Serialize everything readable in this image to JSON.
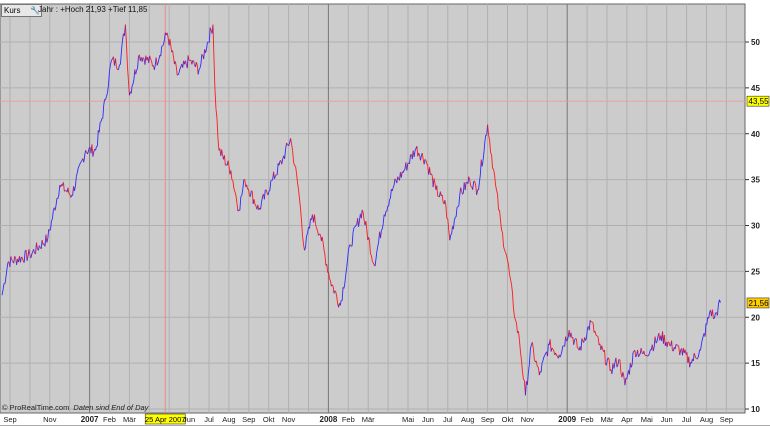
{
  "header": {
    "series_label": "Kurs",
    "info": "Jahr : +Hoch 21,93 +Tief 11,85"
  },
  "footer": {
    "copyright": "© ProRealTime.com",
    "note": "Daten sind End of Day"
  },
  "colors": {
    "up": "#2b2bff",
    "down": "#ff1a1a",
    "plot_bg": "#cccccc",
    "highlight": "#ffff00",
    "last": "#ffcc00"
  },
  "chart_data": {
    "type": "line",
    "title": "Kurs",
    "x_unit": "months since Sep 2006",
    "ylim": [
      10,
      54
    ],
    "y_ticks": [
      10,
      15,
      20,
      25,
      30,
      35,
      40,
      45,
      50
    ],
    "x_range": [
      -0.5,
      37
    ],
    "x_ticks": [
      {
        "m": 0,
        "label": "Sep"
      },
      {
        "m": 2,
        "label": "Nov"
      },
      {
        "m": 4,
        "label": "2007",
        "year": true
      },
      {
        "m": 5,
        "label": "Feb"
      },
      {
        "m": 6,
        "label": "Mär"
      },
      {
        "m": 7.8,
        "label": "25 Apr 2007",
        "highlight": true
      },
      {
        "m": 9,
        "label": "Jun"
      },
      {
        "m": 10,
        "label": "Jul"
      },
      {
        "m": 11,
        "label": "Aug"
      },
      {
        "m": 12,
        "label": "Sep"
      },
      {
        "m": 13,
        "label": "Okt"
      },
      {
        "m": 14,
        "label": "Nov"
      },
      {
        "m": 16,
        "label": "2008",
        "year": true
      },
      {
        "m": 17,
        "label": "Feb"
      },
      {
        "m": 18,
        "label": "Mär"
      },
      {
        "m": 20,
        "label": "Mai"
      },
      {
        "m": 21,
        "label": "Jun"
      },
      {
        "m": 22,
        "label": "Jul"
      },
      {
        "m": 23,
        "label": "Aug"
      },
      {
        "m": 24,
        "label": "Sep"
      },
      {
        "m": 25,
        "label": "Okt"
      },
      {
        "m": 26,
        "label": "Nov"
      },
      {
        "m": 28,
        "label": "2009",
        "year": true
      },
      {
        "m": 29,
        "label": "Feb"
      },
      {
        "m": 30,
        "label": "Mär"
      },
      {
        "m": 31,
        "label": "Apr"
      },
      {
        "m": 32,
        "label": "Mai"
      },
      {
        "m": 33,
        "label": "Jun"
      },
      {
        "m": 34,
        "label": "Jul"
      },
      {
        "m": 35,
        "label": "Aug"
      },
      {
        "m": 36,
        "label": "Sep"
      }
    ],
    "cursor": {
      "m": 7.8,
      "value": 43.55,
      "label": "43,55"
    },
    "last": {
      "value": 21.56,
      "label": "21,56"
    },
    "points": [
      [
        -0.4,
        22.4
      ],
      [
        -0.1,
        26
      ],
      [
        1.0,
        26.8
      ],
      [
        1.9,
        28.6
      ],
      [
        2.5,
        34.4
      ],
      [
        3.1,
        33.3
      ],
      [
        3.8,
        38.2
      ],
      [
        4.3,
        38.2
      ],
      [
        4.8,
        43.7
      ],
      [
        5.1,
        48
      ],
      [
        5.5,
        47.5
      ],
      [
        5.8,
        51.9
      ],
      [
        6.0,
        44.2
      ],
      [
        6.5,
        48.6
      ],
      [
        7.3,
        47.5
      ],
      [
        7.9,
        51
      ],
      [
        8.4,
        46.4
      ],
      [
        9.0,
        48
      ],
      [
        9.5,
        47
      ],
      [
        10.2,
        51.9
      ],
      [
        10.3,
        44.8
      ],
      [
        10.5,
        38.2
      ],
      [
        11.1,
        36
      ],
      [
        11.5,
        31.7
      ],
      [
        11.8,
        35
      ],
      [
        12.5,
        31.7
      ],
      [
        13.2,
        35
      ],
      [
        13.7,
        37.2
      ],
      [
        14.1,
        39.5
      ],
      [
        14.5,
        33.9
      ],
      [
        14.8,
        27.3
      ],
      [
        15.2,
        31.2
      ],
      [
        15.6,
        29
      ],
      [
        16.1,
        24
      ],
      [
        16.6,
        21.3
      ],
      [
        17.1,
        27.9
      ],
      [
        17.7,
        31.7
      ],
      [
        18.3,
        25.7
      ],
      [
        18.8,
        31.2
      ],
      [
        19.3,
        34.4
      ],
      [
        19.8,
        36
      ],
      [
        20.4,
        38.4
      ],
      [
        20.9,
        37.1
      ],
      [
        21.4,
        33.9
      ],
      [
        21.9,
        32.2
      ],
      [
        22.1,
        28.4
      ],
      [
        22.6,
        33.3
      ],
      [
        23.1,
        35
      ],
      [
        23.5,
        33.9
      ],
      [
        24.0,
        41
      ],
      [
        24.4,
        34.4
      ],
      [
        24.7,
        29.5
      ],
      [
        25.0,
        26.2
      ],
      [
        25.4,
        19.7
      ],
      [
        25.6,
        17.5
      ],
      [
        25.9,
        11.5
      ],
      [
        26.2,
        17
      ],
      [
        26.6,
        13.7
      ],
      [
        27.1,
        17
      ],
      [
        27.6,
        15.9
      ],
      [
        28.1,
        18.6
      ],
      [
        28.6,
        16.4
      ],
      [
        29.2,
        19.5
      ],
      [
        29.6,
        17
      ],
      [
        30.2,
        14.3
      ],
      [
        30.6,
        15.4
      ],
      [
        30.9,
        12.6
      ],
      [
        31.4,
        16.4
      ],
      [
        31.9,
        15.9
      ],
      [
        32.7,
        18
      ],
      [
        33.2,
        16.9
      ],
      [
        33.7,
        16.4
      ],
      [
        34.2,
        15.1
      ],
      [
        34.7,
        16.4
      ],
      [
        35.2,
        20.8
      ],
      [
        35.4,
        19.9
      ],
      [
        35.7,
        21.6
      ]
    ]
  }
}
